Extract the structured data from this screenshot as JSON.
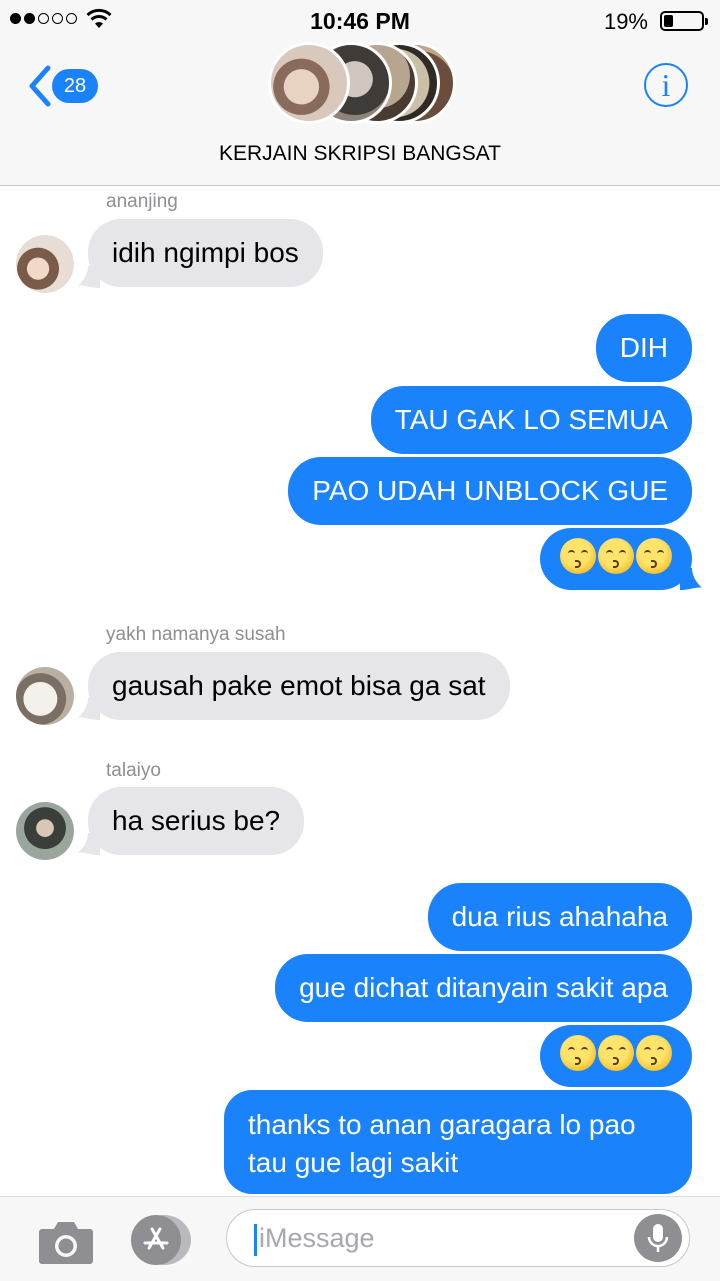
{
  "status_bar": {
    "time": "10:46 PM",
    "battery_percent": "19%",
    "signal_bars": 2,
    "signal_total": 5,
    "battery_level": 0.19
  },
  "header": {
    "back_count": "28",
    "group_name": "KERJAIN SKRIPSI BANGSAT",
    "info_label": "i"
  },
  "messages": [
    {
      "sender": "ananjing",
      "text": "idih ngimpi bos"
    },
    {
      "text": "DIH"
    },
    {
      "text": "TAU GAK LO SEMUA"
    },
    {
      "text": "PAO UDAH UNBLOCK GUE"
    },
    {
      "emoji": "kissing-face-emoji",
      "count": 3
    },
    {
      "sender": "yakh namanya susah",
      "text": "gausah pake emot bisa ga sat"
    },
    {
      "sender": "talaiyo",
      "text": "ha serius be?"
    },
    {
      "text": "dua rius ahahaha"
    },
    {
      "text": "gue dichat ditanyain sakit apa"
    },
    {
      "emoji": "kissing-face-emoji",
      "count": 3
    },
    {
      "text": "thanks to anan garagara lo pao tau gue lagi sakit"
    }
  ],
  "input_bar": {
    "placeholder": "iMessage",
    "icons": [
      "camera-icon",
      "app-store-icon",
      "microphone-icon"
    ]
  },
  "colors": {
    "outgoing_bubble": "#1a82fb",
    "incoming_bubble": "#e5e5ea",
    "accent": "#1a82fb"
  }
}
